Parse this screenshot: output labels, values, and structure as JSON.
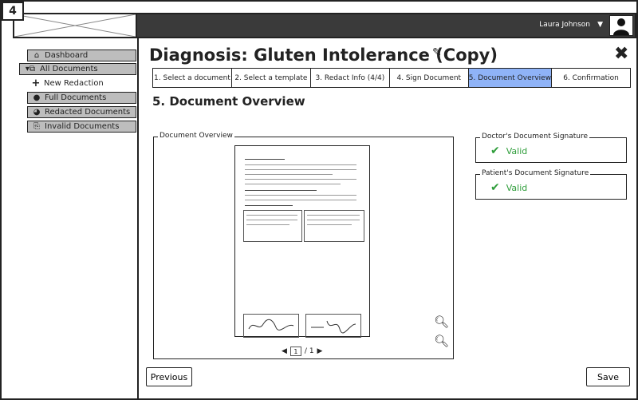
{
  "badge": "4",
  "header": {
    "user_name": "Laura Johnson",
    "caret": "▼"
  },
  "sidebar": {
    "items": [
      {
        "label": "Dashboard",
        "icon": "⌂"
      },
      {
        "label": "All Documents",
        "icon": "▾⧉"
      },
      {
        "label": "New Redaction",
        "icon": "+"
      },
      {
        "label": "Full Documents",
        "icon": "●"
      },
      {
        "label": "Redacted Documents",
        "icon": "◕"
      },
      {
        "label": "Invalid Documents",
        "icon": "⎘"
      }
    ]
  },
  "page": {
    "title": "Diagnosis: Gluten Intolerance (Copy)",
    "section_title": "5. Document Overview"
  },
  "steps": [
    {
      "label": "1. Select a document"
    },
    {
      "label": "2. Select a template"
    },
    {
      "label": "3. Redact Info (4/4)"
    },
    {
      "label": "4. Sign Document"
    },
    {
      "label": "5. Document Overview",
      "active": true
    },
    {
      "label": "6. Confirmation"
    }
  ],
  "overview": {
    "legend": "Document Overview",
    "page_current": "1",
    "page_total": "/ 1"
  },
  "doctor_signature": {
    "legend": "Doctor's Document Signature",
    "status": "Valid"
  },
  "patient_signature": {
    "legend": "Patient's Document Signature",
    "status": "Valid"
  },
  "buttons": {
    "previous": "Previous",
    "save": "Save"
  }
}
